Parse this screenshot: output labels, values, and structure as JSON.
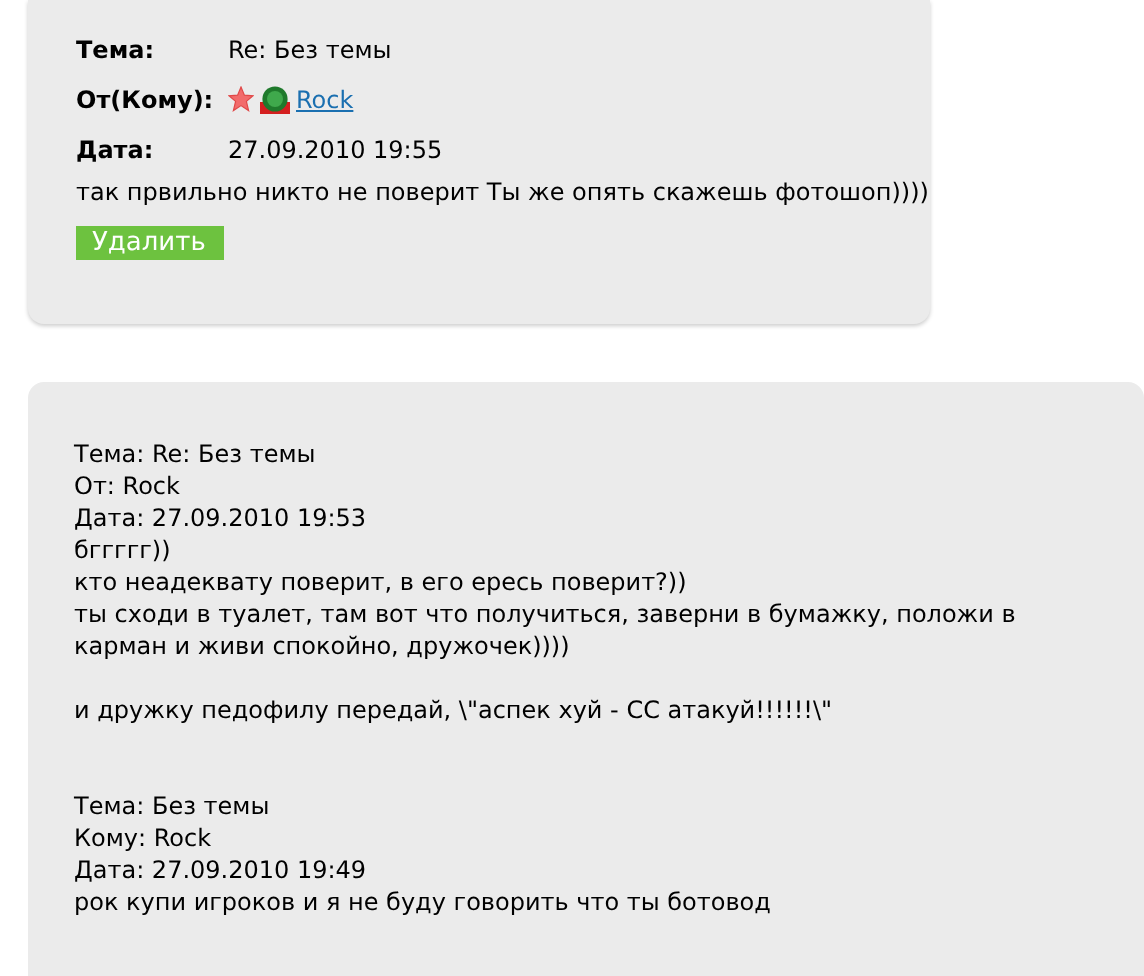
{
  "message": {
    "fields": [
      {
        "kind": "text",
        "label": "Тема:",
        "value": "Re: Без темы"
      },
      {
        "kind": "user",
        "label": "От(Кому):",
        "value": "Rock"
      },
      {
        "kind": "text",
        "label": "Дата:",
        "value": "27.09.2010 19:55"
      }
    ],
    "body": "так првильно никто не поверит Ты же опять скажешь фотошоп))))",
    "delete_button": "Удалить"
  },
  "quoted": [
    {
      "paragraphs": [
        [
          "Тема: Re: Без темы",
          "От: Rock",
          "Дата: 27.09.2010 19:53",
          "бггггг))",
          "кто неадеквату поверит, в его ересь поверит?))",
          "ты сходи в туалет, там вот что получиться, заверни в бумажку, положи в карман и живи спокойно, дружочек))))"
        ],
        [
          "и дружку педофилу передай, \\\"аспек хуй - СС атакуй!!!!!!\\\""
        ]
      ]
    },
    {
      "paragraphs": [
        [
          "Тема: Без темы",
          "Кому: Rock",
          "Дата: 27.09.2010 19:49",
          "рок купи игроков и я не буду говорить что ты ботовод"
        ]
      ]
    }
  ]
}
